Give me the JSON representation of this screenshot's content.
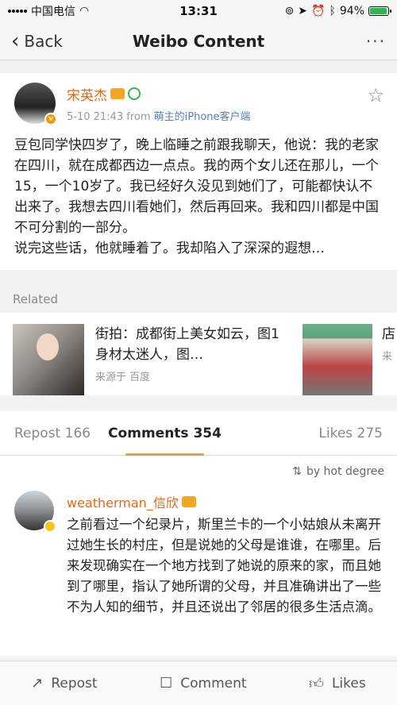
{
  "status_bar": {
    "carrier": "中国电信",
    "time": "13:31",
    "battery": "94%",
    "battery_level": 0.94,
    "battery_color": "#2db84d"
  },
  "nav": {
    "back_label": "Back",
    "title": "Weibo Content",
    "more_label": "···"
  },
  "post": {
    "author": "宋英杰",
    "time": "5-10 21:43",
    "from_label": "from",
    "source": "萌主的iPhone客户端",
    "name_color": "#e2691a",
    "paragraphs": [
      "豆包同学快四岁了，晚上临睡之前跟我聊天，他说：我的老家在四川，就在成都西边一点点。我的两个女儿还在那儿，一个15，一个10岁了。我已经好久没见到她们了，可能都快认不出来了。我想去四川看她们，然后再回来。我和四川都是中国不可分割的一部分。",
      "说完这些话，他就睡着了。我却陷入了深深的遐想…"
    ]
  },
  "related": {
    "header": "Related",
    "items": [
      {
        "title": "街拍：成都街上美女如云，图1身材太迷人，图…",
        "source": "来源于 百度"
      },
      {
        "title": "店",
        "source": "来"
      }
    ]
  },
  "tabs": {
    "repost": "Repost 166",
    "comments": "Comments 354",
    "likes": "Likes 275",
    "accent": "#f39a2e"
  },
  "sort": {
    "label": "by hot degree"
  },
  "comment": {
    "author": "weatherman_信欣",
    "text": "之前看过一个纪录片，斯里兰卡的一个小姑娘从未离开过她生长的村庄，但是说她的父母是谁谁，在哪里。后来发现确实在一个地方找到了她说的原来的家，而且她到了哪里，指认了她所谓的父母，并且准确讲出了一些不为人知的细节，并且还说出了邻居的很多生活点滴。"
  },
  "bottom_bar": {
    "repost": "Repost",
    "comment": "Comment",
    "likes": "Likes"
  }
}
